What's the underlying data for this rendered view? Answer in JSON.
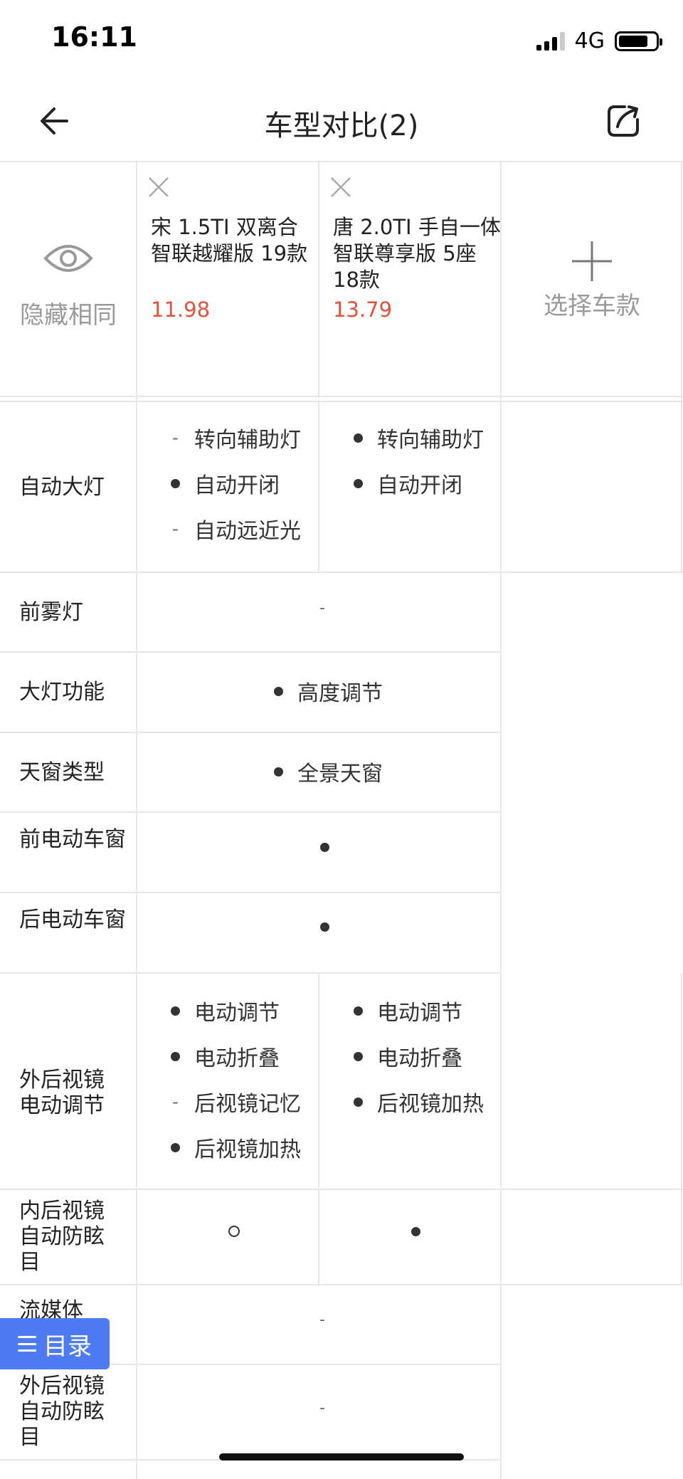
{
  "status": {
    "time": "16:11",
    "network": "4G"
  },
  "nav": {
    "title": "车型对比(2)"
  },
  "header": {
    "hide_same": "隐藏相同",
    "select_car": "选择车款",
    "cars": [
      {
        "name": "宋 1.5TI 双离合 智联越耀版 19款",
        "price": "11.98"
      },
      {
        "name": "唐 2.0TI 手自一体 智联尊享版 5座 18款",
        "price": "13.79"
      }
    ]
  },
  "rows": {
    "auto_headlight": {
      "label": "自动大灯",
      "car1": [
        {
          "mark": "-",
          "text": "转向辅助灯"
        },
        {
          "mark": "●",
          "text": "自动开闭"
        },
        {
          "mark": "-",
          "text": "自动远近光"
        }
      ],
      "car2": [
        {
          "mark": "●",
          "text": "转向辅助灯"
        },
        {
          "mark": "●",
          "text": "自动开闭"
        }
      ]
    },
    "front_fog": {
      "label": "前雾灯",
      "value": "-"
    },
    "headlight_function": {
      "label": "大灯功能",
      "value": "高度调节"
    },
    "sunroof": {
      "label": "天窗类型",
      "value": "全景天窗"
    },
    "front_window": {
      "label": "前电动车窗",
      "value": "●"
    },
    "rear_window": {
      "label": "后电动车窗",
      "value": "●"
    },
    "mirror_adjust": {
      "label": "外后视镜电动调节",
      "car1": [
        {
          "mark": "●",
          "text": "电动调节"
        },
        {
          "mark": "●",
          "text": "电动折叠"
        },
        {
          "mark": "-",
          "text": "后视镜记忆"
        },
        {
          "mark": "●",
          "text": "后视镜加热"
        }
      ],
      "car2": [
        {
          "mark": "●",
          "text": "电动调节"
        },
        {
          "mark": "●",
          "text": "电动折叠"
        },
        {
          "mark": "●",
          "text": "后视镜加热"
        }
      ]
    },
    "inner_mirror": {
      "label": "内后视镜自动防眩目",
      "car1": "○",
      "car2": "●"
    },
    "streaming": {
      "label": "流媒体",
      "value": "-"
    },
    "outer_mirror_antiglare": {
      "label": "外后视镜自动防眩目",
      "value": "-"
    }
  },
  "catalog": {
    "label": "目录"
  }
}
